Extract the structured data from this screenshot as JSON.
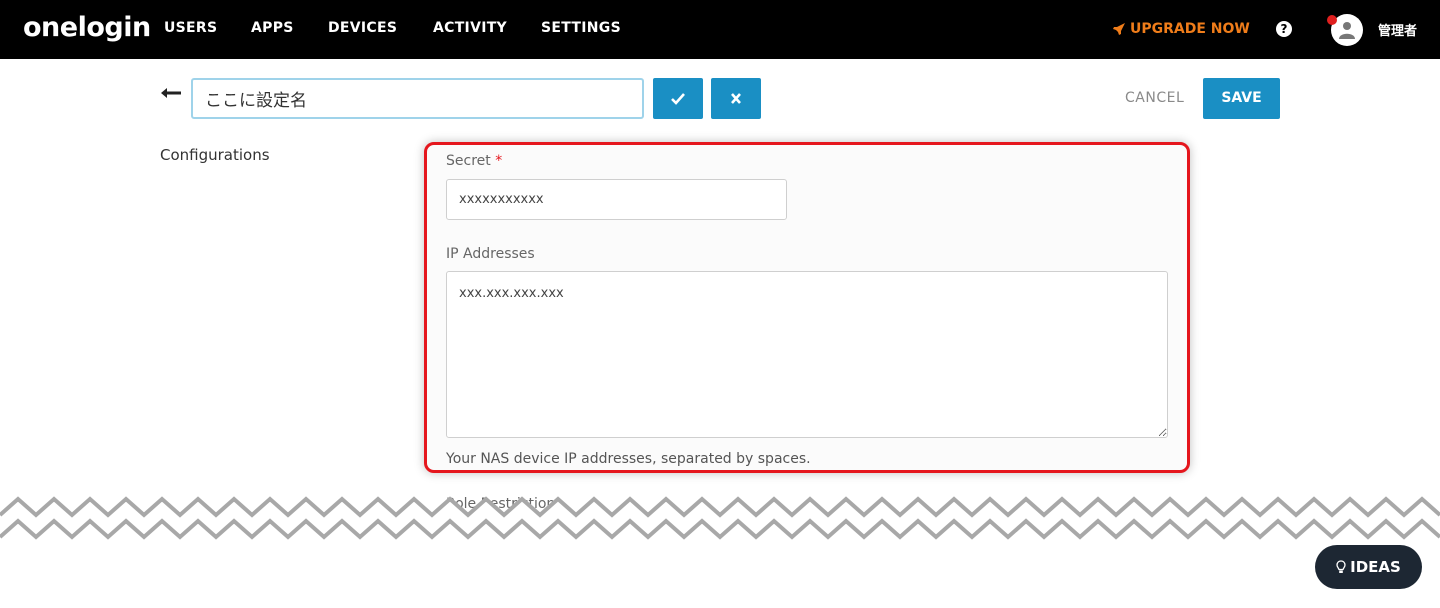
{
  "header": {
    "logo": "onelogin",
    "nav": [
      "USERS",
      "APPS",
      "DEVICES",
      "ACTIVITY",
      "SETTINGS"
    ],
    "upgrade_label": "UPGRADE NOW",
    "help_label": "?",
    "user_name": "管理者",
    "accent": "#f07d1a"
  },
  "title_row": {
    "name_value": "ここに設定名",
    "cancel_label": "CANCEL",
    "save_label": "SAVE",
    "button_color": "#1a8fc4"
  },
  "section": {
    "label": "Configurations"
  },
  "form": {
    "secret_label": "Secret",
    "secret_required": "*",
    "secret_value": "xxxxxxxxxxx",
    "ip_label": "IP Addresses",
    "ip_value": "xxx.xxx.xxx.xxx",
    "ip_help": "Your NAS device IP addresses, separated by spaces.",
    "next_label": "Role Restriction",
    "highlight_color": "#e5161d"
  },
  "ideas": {
    "label": "IDEAS"
  }
}
